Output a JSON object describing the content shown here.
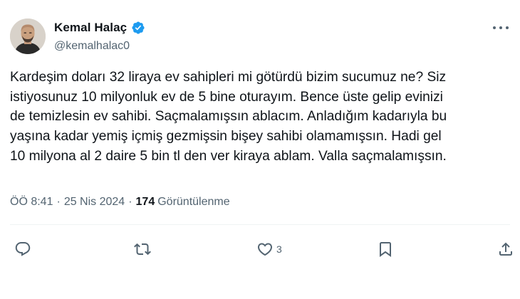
{
  "author": {
    "display_name": "Kemal Halaç",
    "handle": "@kemalhalac0",
    "verified": true
  },
  "tweet": {
    "text": "Kardeşim doları 32 liraya ev sahipleri mi götürdü bizim sucumuz ne? Siz\nistiyosunuz 10 milyonluk ev de 5 bine oturayım. Bence üste gelip evinizi\nde temizlesin ev sahibi. Saçmalamışsın ablacım. Anladığım kadarıyla bu\nyaşına kadar yemiş içmiş gezmişsin bişey sahibi olamamışsın. Hadi gel\n10 milyona al 2 daire 5 bin tl den ver kiraya ablam. Valla saçmalamışsın."
  },
  "meta": {
    "time": "ÖÖ 8:41",
    "separator": "·",
    "date": "25 Nis 2024",
    "views_count": "174",
    "views_label": "Görüntülenme"
  },
  "actions": {
    "like_count": "3"
  },
  "icons": {
    "reply": "reply-icon",
    "retweet": "retweet-icon",
    "like": "heart-icon",
    "bookmark": "bookmark-icon",
    "share": "share-icon",
    "more": "more-options-icon",
    "verified": "verified-badge-icon"
  },
  "colors": {
    "text_primary": "#0f1419",
    "text_secondary": "#536471",
    "verified_blue": "#1d9bf0",
    "divider": "#eff3f4"
  }
}
